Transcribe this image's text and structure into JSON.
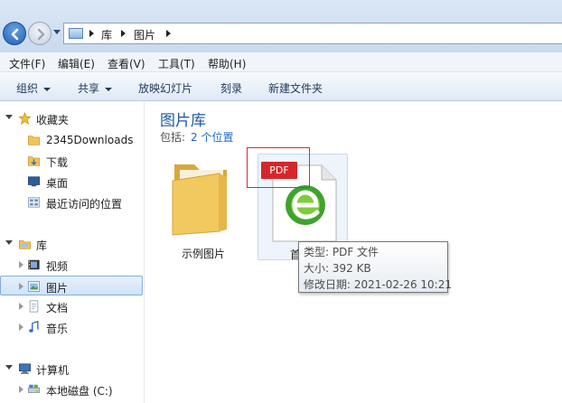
{
  "address": {
    "crumbs": [
      "库",
      "图片"
    ]
  },
  "menu": {
    "items": [
      "文件(F)",
      "编辑(E)",
      "查看(V)",
      "工具(T)",
      "帮助(H)"
    ]
  },
  "toolbar": {
    "organize": "组织",
    "share": "共享",
    "slideshow": "放映幻灯片",
    "burn": "刻录",
    "new_folder": "新建文件夹"
  },
  "nav": {
    "favorites": "收藏夹",
    "favorites_items": [
      "2345Downloads",
      "下载",
      "桌面",
      "最近访问的位置"
    ],
    "libraries": "库",
    "library_items": [
      "视频",
      "图片",
      "文档",
      "音乐"
    ],
    "computer": "计算机",
    "computer_items": [
      "本地磁盘 (C:)"
    ]
  },
  "content": {
    "title": "图片库",
    "includes_label": "包括:",
    "includes_link": "2 个位置",
    "files": [
      {
        "name": "示例图片"
      },
      {
        "name": "首"
      }
    ],
    "pdf_badge": "PDF"
  },
  "tooltip": {
    "type": "类型: PDF 文件",
    "size": "大小: 392 KB",
    "modified": "修改日期: 2021-02-26 10:21"
  },
  "colors": {
    "accent": "#1e5aa0",
    "highlight": "#e0282d",
    "pdf_red": "#d6262a"
  }
}
